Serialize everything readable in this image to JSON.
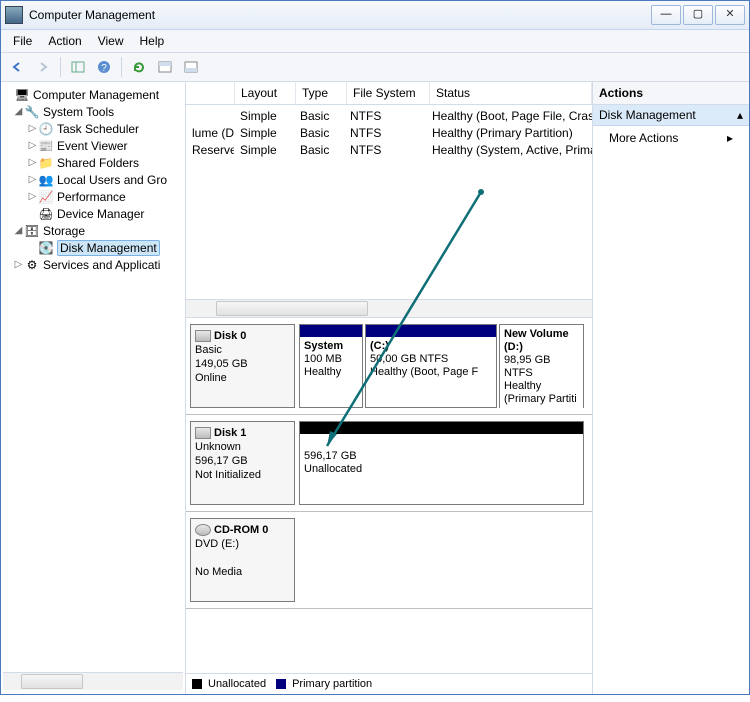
{
  "window": {
    "title": "Computer Management"
  },
  "menu": {
    "file": "File",
    "action": "Action",
    "view": "View",
    "help": "Help"
  },
  "tree": {
    "root": "Computer Management",
    "systemTools": "System Tools",
    "st": {
      "taskScheduler": "Task Scheduler",
      "eventViewer": "Event Viewer",
      "sharedFolders": "Shared Folders",
      "localUsers": "Local Users and Gro",
      "performance": "Performance",
      "deviceManager": "Device Manager"
    },
    "storage": "Storage",
    "diskManagement": "Disk Management",
    "services": "Services and Applicati"
  },
  "grid": {
    "headers": {
      "layout": "Layout",
      "type": "Type",
      "fs": "File System",
      "status": "Status"
    },
    "rows": [
      {
        "name": "",
        "layout": "Simple",
        "type": "Basic",
        "fs": "NTFS",
        "status": "Healthy (Boot, Page File, Crash Dump, Primary Part"
      },
      {
        "name": "lume (D:)",
        "layout": "Simple",
        "type": "Basic",
        "fs": "NTFS",
        "status": "Healthy (Primary Partition)"
      },
      {
        "name": "Reserved",
        "layout": "Simple",
        "type": "Basic",
        "fs": "NTFS",
        "status": "Healthy (System, Active, Primary Partition)"
      }
    ]
  },
  "disks": {
    "d0": {
      "name": "Disk 0",
      "type": "Basic",
      "size": "149,05 GB",
      "state": "Online",
      "v0": {
        "title": "System",
        "l1": "100 MB",
        "l2": "Healthy"
      },
      "v1": {
        "title": "(C:)",
        "l1": "50,00 GB NTFS",
        "l2": "Healthy (Boot, Page F"
      },
      "v2": {
        "title": "New Volume  (D:)",
        "l1": "98,95 GB NTFS",
        "l2": "Healthy (Primary Partiti"
      }
    },
    "d1": {
      "name": "Disk 1",
      "type": "Unknown",
      "size": "596,17 GB",
      "state": "Not Initialized",
      "u": {
        "l1": "596,17 GB",
        "l2": "Unallocated"
      }
    },
    "cd": {
      "name": "CD-ROM 0",
      "type": "DVD (E:)",
      "state": "No Media"
    }
  },
  "legend": {
    "unalloc": "Unallocated",
    "primary": "Primary partition"
  },
  "actions": {
    "header": "Actions",
    "section": "Disk Management",
    "more": "More Actions"
  }
}
